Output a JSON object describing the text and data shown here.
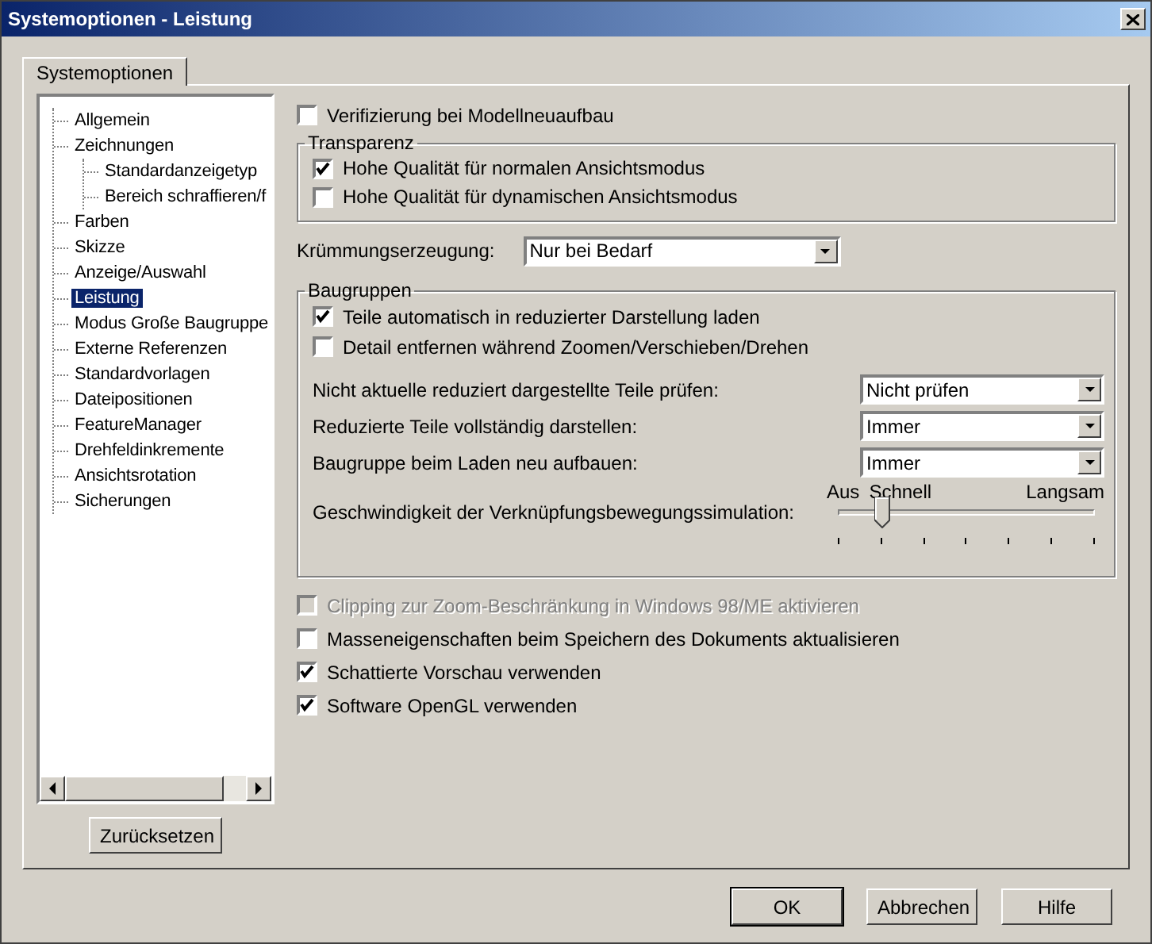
{
  "window": {
    "title": "Systemoptionen - Leistung"
  },
  "tabs": [
    {
      "label": "Systemoptionen",
      "selected": true
    }
  ],
  "tree": [
    {
      "label": "Allgemein",
      "selected": false
    },
    {
      "label": "Zeichnungen",
      "selected": false,
      "children": [
        {
          "label": "Standardanzeigetyp",
          "selected": false
        },
        {
          "label": "Bereich schraffieren/f",
          "selected": false
        }
      ]
    },
    {
      "label": "Farben",
      "selected": false
    },
    {
      "label": "Skizze",
      "selected": false
    },
    {
      "label": "Anzeige/Auswahl",
      "selected": false
    },
    {
      "label": "Leistung",
      "selected": true
    },
    {
      "label": "Modus Große Baugruppe",
      "selected": false
    },
    {
      "label": "Externe Referenzen",
      "selected": false
    },
    {
      "label": "Standardvorlagen",
      "selected": false
    },
    {
      "label": "Dateipositionen",
      "selected": false
    },
    {
      "label": "FeatureManager",
      "selected": false
    },
    {
      "label": "Drehfeldinkremente",
      "selected": false
    },
    {
      "label": "Ansichtsrotation",
      "selected": false
    },
    {
      "label": "Sicherungen",
      "selected": false
    }
  ],
  "reset_button": "Zurücksetzen",
  "options_top": [
    {
      "label": "Verifizierung bei Modellneuaufbau",
      "checked": false,
      "disabled": false
    }
  ],
  "transparency": {
    "title": "Transparenz",
    "options": [
      {
        "label": "Hohe Qualität für normalen Ansichtsmodus",
        "checked": true,
        "disabled": false
      },
      {
        "label": "Hohe Qualität für dynamischen Ansichtsmodus",
        "checked": false,
        "disabled": false
      }
    ]
  },
  "curvature": {
    "label": "Krümmungserzeugung:",
    "value": "Nur bei Bedarf"
  },
  "assemblies": {
    "title": "Baugruppen",
    "options": [
      {
        "label": "Teile automatisch in reduzierter Darstellung laden",
        "checked": true,
        "disabled": false
      },
      {
        "label": "Detail entfernen während Zoomen/Verschieben/Drehen",
        "checked": false,
        "disabled": false
      }
    ],
    "dropdowns": [
      {
        "label": "Nicht aktuelle reduziert dargestellte Teile prüfen:",
        "value": "Nicht prüfen"
      },
      {
        "label": "Reduzierte Teile vollständig darstellen:",
        "value": "Immer"
      },
      {
        "label": "Baugruppe beim Laden neu aufbauen:",
        "value": "Immer"
      }
    ],
    "slider": {
      "label": "Geschwindigkeit der Verknüpfungsbewegungssimulation:",
      "marks": [
        "Aus",
        "Schnell",
        "Langsam"
      ],
      "level": 0.167
    }
  },
  "options_bottom": [
    {
      "label": "Clipping zur Zoom-Beschränkung in Windows 98/ME aktivieren",
      "checked": false,
      "disabled": true
    },
    {
      "label": "Masseneigenschaften beim Speichern des Dokuments aktualisieren",
      "checked": false,
      "disabled": false
    },
    {
      "label": "Schattierte Vorschau verwenden",
      "checked": true,
      "disabled": false
    },
    {
      "label": "Software OpenGL verwenden",
      "checked": true,
      "disabled": false
    }
  ],
  "buttons": [
    {
      "label": "OK",
      "default": true
    },
    {
      "label": "Abbrechen",
      "default": false
    },
    {
      "label": "Hilfe",
      "default": false
    }
  ]
}
